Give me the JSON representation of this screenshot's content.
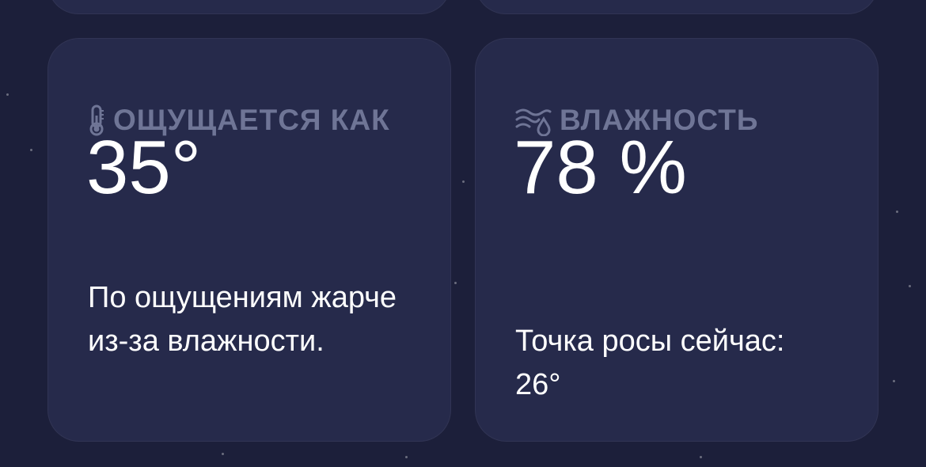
{
  "feels_like": {
    "icon": "thermometer-icon",
    "title": "ОЩУЩАЕТСЯ КАК",
    "value": "35°",
    "description": "По ощущениям жарче из-за влажности."
  },
  "humidity": {
    "icon": "humidity-icon",
    "title": "ВЛАЖНОСТЬ",
    "value": "78 %",
    "description": "Точка росы сейчас: 26°"
  },
  "colors": {
    "background": "#1c1f3a",
    "card": "#262a4b",
    "header_text": "#6f7596",
    "value_text": "#ffffff"
  }
}
